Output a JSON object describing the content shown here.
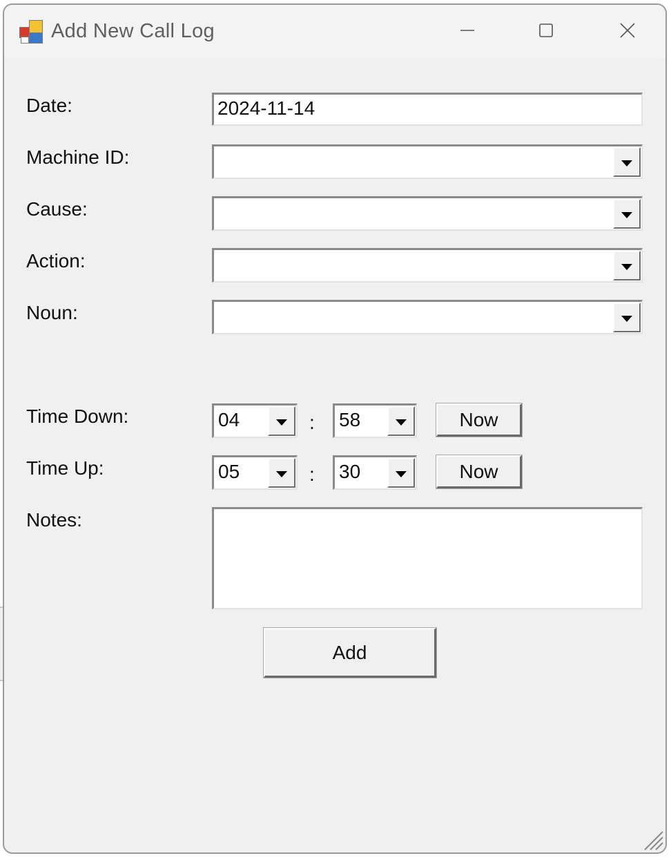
{
  "window": {
    "title": "Add New Call Log",
    "controls": [
      "minimize-icon",
      "maximize-icon",
      "close-icon"
    ]
  },
  "form": {
    "date": {
      "label": "Date:",
      "value": "2024-11-14"
    },
    "machine_id": {
      "label": "Machine ID:",
      "value": ""
    },
    "cause": {
      "label": "Cause:",
      "value": ""
    },
    "action": {
      "label": "Action:",
      "value": ""
    },
    "noun": {
      "label": "Noun:",
      "value": ""
    },
    "time_down": {
      "label": "Time Down:",
      "hour": "04",
      "minute": "58",
      "separator": ":",
      "now_label": "Now"
    },
    "time_up": {
      "label": "Time Up:",
      "hour": "05",
      "minute": "30",
      "separator": ":",
      "now_label": "Now"
    },
    "notes": {
      "label": "Notes:",
      "value": ""
    },
    "add_label": "Add"
  },
  "colors": {
    "window_bg": "#f0f0f0",
    "field_bg": "#ffffff",
    "title_text": "#5f5f5f"
  }
}
